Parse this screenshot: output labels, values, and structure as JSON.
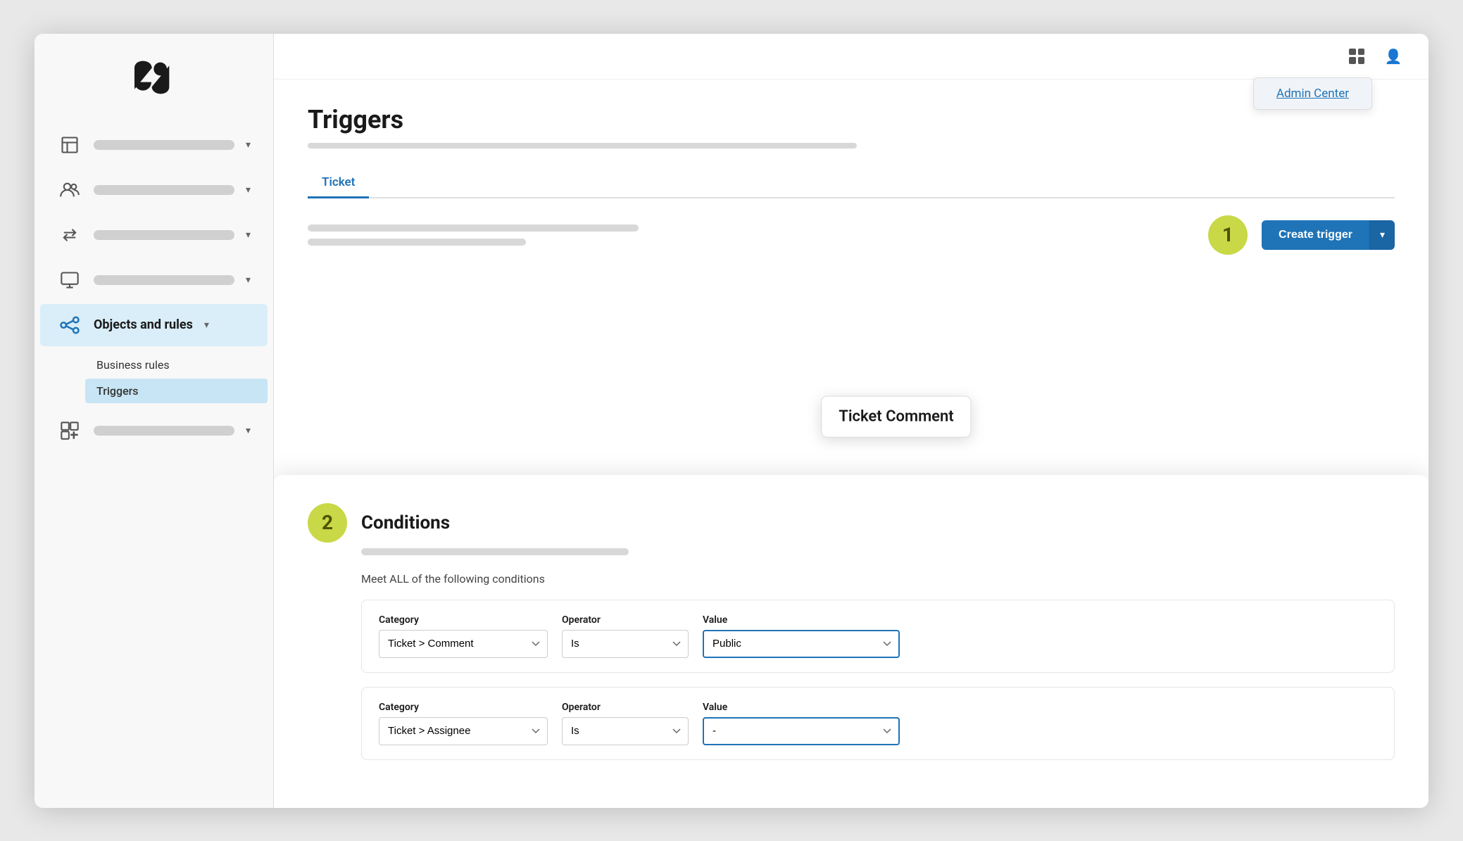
{
  "sidebar": {
    "logo_alt": "Zendesk Logo",
    "nav_items": [
      {
        "id": "workspace",
        "icon": "building",
        "active": false,
        "has_chevron": true
      },
      {
        "id": "people",
        "icon": "people",
        "active": false,
        "has_chevron": true
      },
      {
        "id": "routing",
        "icon": "arrows",
        "active": false,
        "has_chevron": true
      },
      {
        "id": "monitor",
        "icon": "monitor",
        "active": false,
        "has_chevron": true
      },
      {
        "id": "objects-and-rules",
        "label": "Objects and rules",
        "icon": "rules",
        "active": true,
        "has_chevron": true
      },
      {
        "id": "apps",
        "icon": "apps",
        "active": false,
        "has_chevron": true
      }
    ],
    "sub_nav": {
      "parent_label": "Business rules",
      "active_item": "Triggers",
      "items": [
        "Business rules",
        "Triggers"
      ]
    }
  },
  "header": {
    "admin_center_label": "Admin Center"
  },
  "page": {
    "title": "Triggers",
    "tabs": [
      {
        "id": "ticket",
        "label": "Ticket",
        "active": true
      }
    ],
    "create_trigger_label": "Create trigger",
    "dropdown_arrow": "▾"
  },
  "step1": {
    "number": "1"
  },
  "conditions": {
    "step_number": "2",
    "title": "Conditions",
    "meet_all_text": "Meet ALL of the following conditions",
    "rows": [
      {
        "category_label": "Category",
        "category_value": "Ticket > Comment",
        "operator_label": "Operator",
        "operator_value": "Is",
        "value_label": "Value",
        "value_value": "Public",
        "value_highlighted": true
      },
      {
        "category_label": "Category",
        "category_value": "Ticket > Assignee",
        "operator_label": "Operator",
        "operator_value": "Is",
        "value_label": "Value",
        "value_value": "-",
        "value_highlighted": true
      }
    ]
  },
  "ticket_comment_tooltip": {
    "label": "Ticket Comment"
  }
}
